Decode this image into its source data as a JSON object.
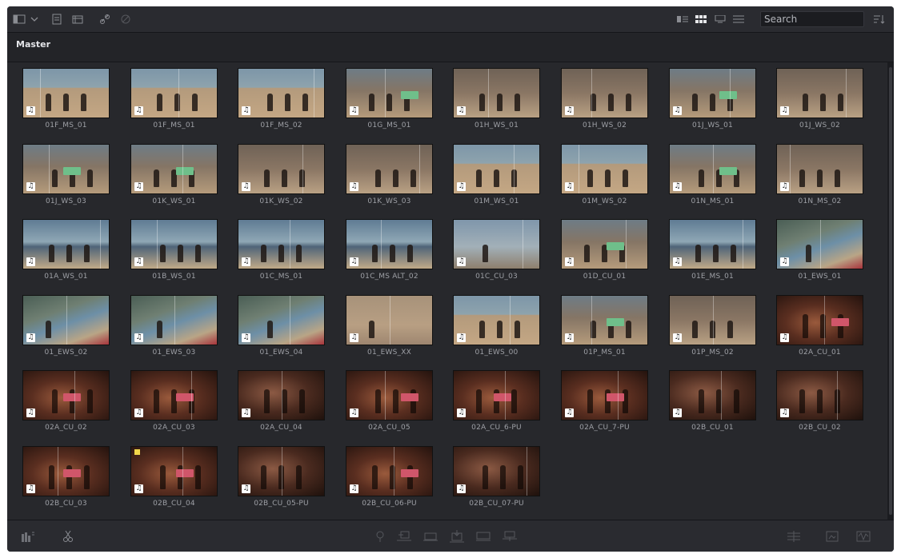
{
  "toolbar": {
    "left_icons": [
      "panel-toggle-icon",
      "chevron-down-icon",
      "new-bin-icon",
      "new-timeline-icon",
      "link-icon",
      "unlink-icon"
    ],
    "view_icons": [
      "metadata-view-icon",
      "thumbnail-view-icon",
      "filmstrip-view-icon",
      "list-view-icon"
    ],
    "search_placeholder": "Search",
    "sort_icon": "sort-icon"
  },
  "bin": {
    "title": "Master"
  },
  "clips": [
    {
      "name": "01F_MS_01",
      "scene": "beach",
      "split": 0.2
    },
    {
      "name": "01F_MS_01",
      "scene": "beach",
      "split": 0.55
    },
    {
      "name": "01F_MS_02",
      "scene": "beach",
      "split": 0.88
    },
    {
      "name": "01G_MS_01",
      "scene": "slate",
      "split": 0.45
    },
    {
      "name": "01H_WS_01",
      "scene": "rock",
      "split": 0.4
    },
    {
      "name": "01H_WS_02",
      "scene": "rock",
      "split": 0.35
    },
    {
      "name": "01J_WS_01",
      "scene": "slate",
      "split": 0.7
    },
    {
      "name": "01J_WS_02",
      "scene": "rock",
      "split": 0.8
    },
    {
      "name": "01J_WS_03",
      "scene": "slate",
      "split": 0.3
    },
    {
      "name": "01K_WS_01",
      "scene": "slate",
      "split": 0.6
    },
    {
      "name": "01K_WS_02",
      "scene": "rock",
      "split": 0.75
    },
    {
      "name": "01K_WS_03",
      "scene": "rock",
      "split": 0.85
    },
    {
      "name": "01M_WS_01",
      "scene": "beach",
      "split": 0.7
    },
    {
      "name": "01M_WS_02",
      "scene": "beach",
      "split": 0.2
    },
    {
      "name": "01N_MS_01",
      "scene": "slate",
      "split": 0.5
    },
    {
      "name": "01N_MS_02",
      "scene": "rock",
      "split": 0.15
    },
    {
      "name": "01A_WS_01",
      "scene": "shore",
      "split": 0.9
    },
    {
      "name": "01B_WS_01",
      "scene": "shore",
      "split": 0.3
    },
    {
      "name": "01C_MS_01",
      "scene": "shore",
      "split": 0.6
    },
    {
      "name": "01C_MS ALT_02",
      "scene": "shore",
      "split": 0.4
    },
    {
      "name": "01C_CU_03",
      "scene": "sky",
      "split": 0.8
    },
    {
      "name": "01D_CU_01",
      "scene": "slate",
      "split": 0.75
    },
    {
      "name": "01E_MS_01",
      "scene": "shore",
      "split": 0.85
    },
    {
      "name": "01_EWS_01",
      "scene": "coast",
      "split": 0.5
    },
    {
      "name": "01_EWS_02",
      "scene": "coast",
      "split": 0.5
    },
    {
      "name": "01_EWS_03",
      "scene": "coast",
      "split": 0.5
    },
    {
      "name": "01_EWS_04",
      "scene": "coast",
      "split": 0.6
    },
    {
      "name": "01_EWS_XX",
      "scene": "sand",
      "split": 0.5
    },
    {
      "name": "01_EWS_00",
      "scene": "beach",
      "split": 0.65
    },
    {
      "name": "01P_MS_01",
      "scene": "slate",
      "split": 0.35
    },
    {
      "name": "01P_MS_02",
      "scene": "rock",
      "split": 0.5
    },
    {
      "name": "02A_CU_01",
      "scene": "night",
      "split": 0.55
    },
    {
      "name": "02A_CU_02",
      "scene": "night",
      "split": 0.6
    },
    {
      "name": "02A_CU_03",
      "scene": "night",
      "split": 0.7
    },
    {
      "name": "02A_CU_04",
      "scene": "face",
      "split": 0.5
    },
    {
      "name": "02A_CU_05",
      "scene": "night",
      "split": 0.45
    },
    {
      "name": "02A_CU_6-PU",
      "scene": "night",
      "split": 0.6
    },
    {
      "name": "02A_CU_7-PU",
      "scene": "night",
      "split": 0.65
    },
    {
      "name": "02B_CU_01",
      "scene": "face",
      "split": 0.6
    },
    {
      "name": "02B_CU_02",
      "scene": "face",
      "split": 0.7
    },
    {
      "name": "02B_CU_03",
      "scene": "night",
      "split": 0.4
    },
    {
      "name": "02B_CU_04",
      "scene": "night",
      "split": 0.6,
      "flag": true
    },
    {
      "name": "02B_CU_05-PU",
      "scene": "face",
      "split": 0.5
    },
    {
      "name": "02B_CU_06-PU",
      "scene": "night",
      "split": 0.55
    },
    {
      "name": "02B_CU_07-PU",
      "scene": "face",
      "split": 0.85
    }
  ],
  "bottom": {
    "left_icons": [
      "audio-meter-icon",
      "cut-icon"
    ],
    "center_icons": [
      "marker-icon",
      "insert-icon",
      "overwrite-icon",
      "replace-icon",
      "fit-to-fill-icon",
      "append-icon"
    ],
    "right_icons": [
      "viewer-icon",
      "inspector-icon",
      "waveform-icon"
    ]
  },
  "colors": {
    "panel": "#1e1f23",
    "grid": "#27282c",
    "toolbar": "#2a2b30",
    "flag": "#f1d74a"
  }
}
